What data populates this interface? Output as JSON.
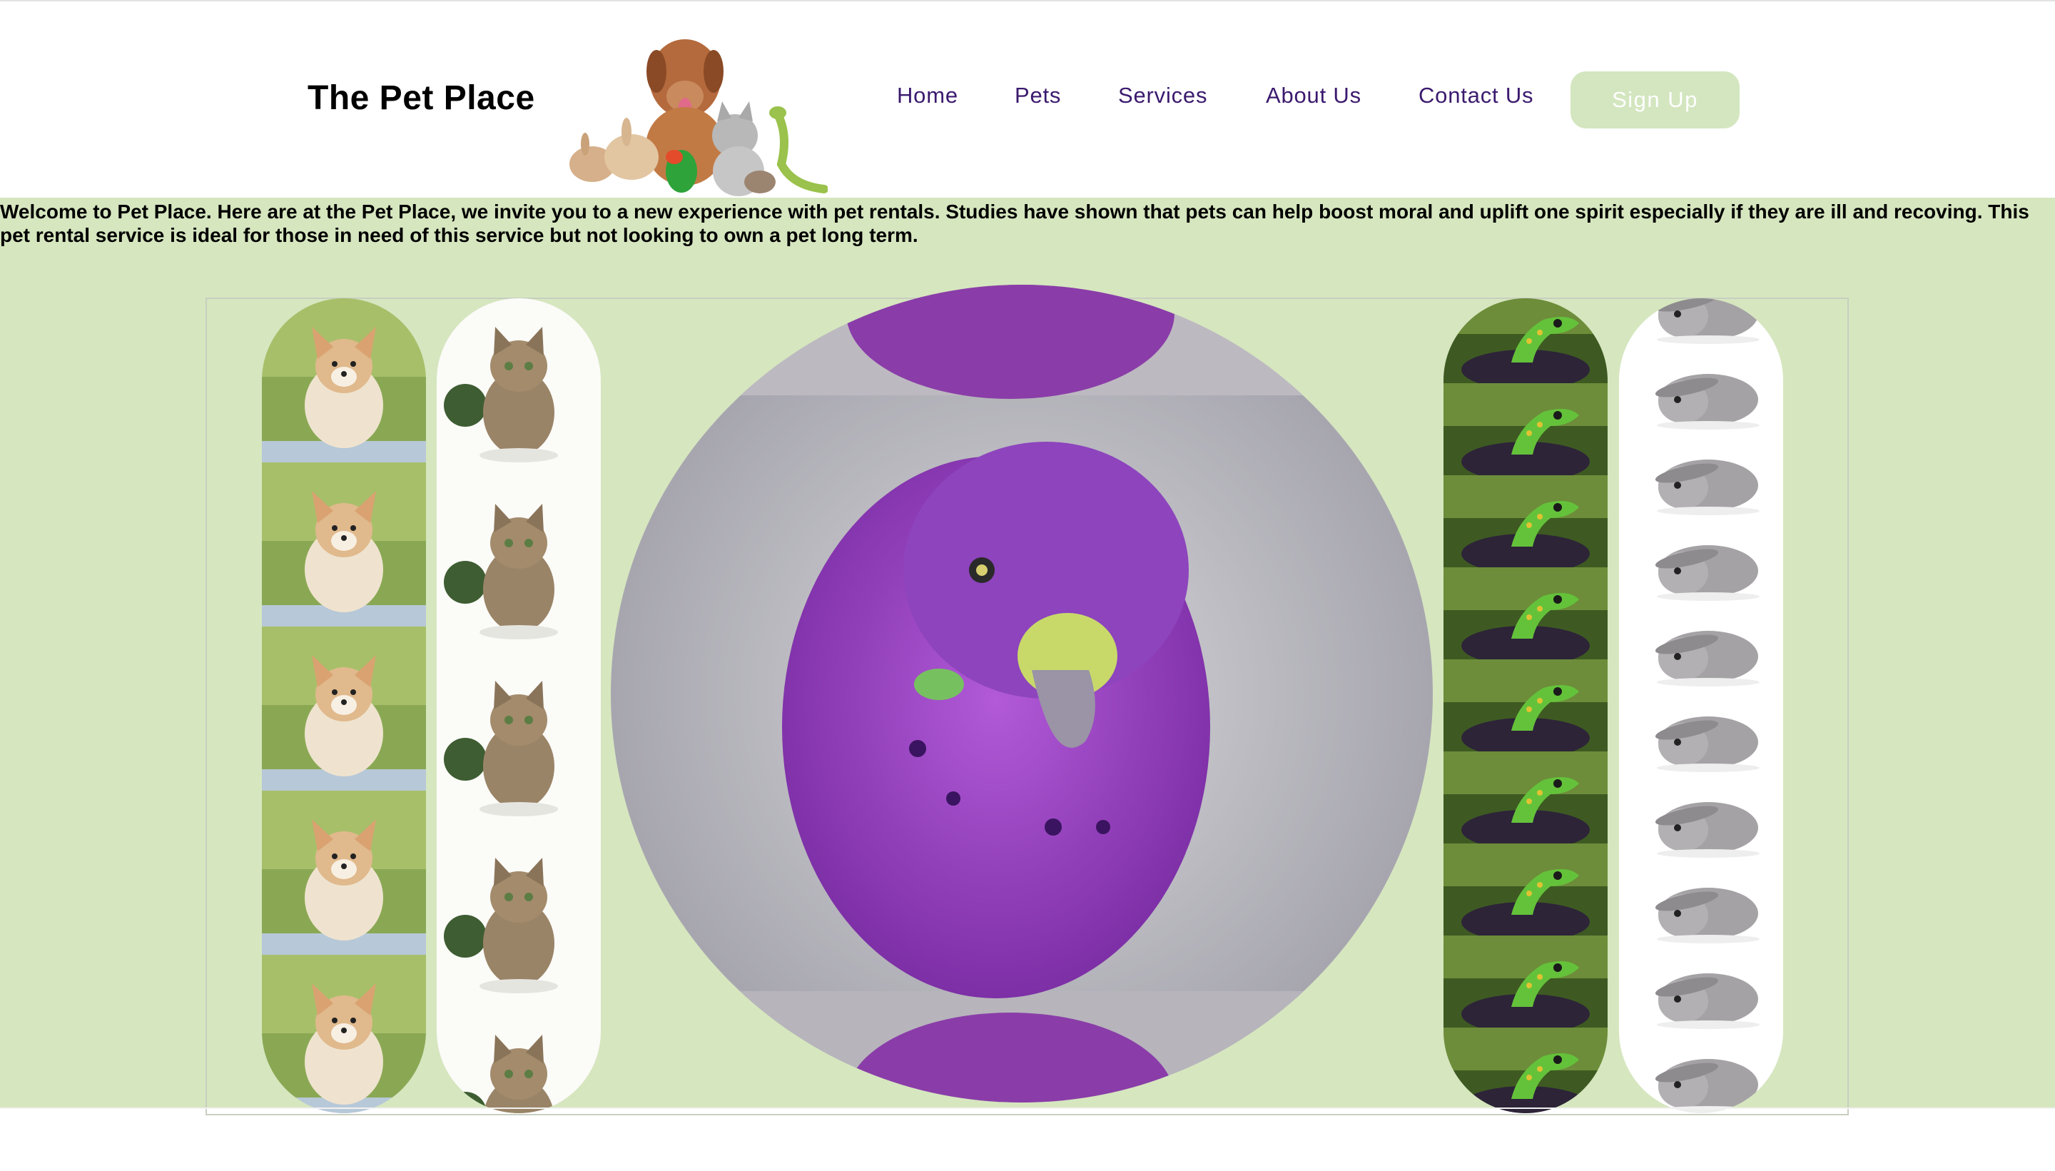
{
  "header": {
    "brand": "The Pet Place",
    "nav": [
      "Home",
      "Pets",
      "Services",
      "About Us",
      "Contact Us"
    ],
    "signup_label": "Sign Up"
  },
  "intro": {
    "text": "Welcome to Pet Place. Here are at the Pet Place, we invite you to a new experience with pet rentals. Studies have shown that pets can help boost moral and uplift one spirit especially if they are ill and recoving. This pet rental service is ideal for those in need of this service but not looking to own a pet long term."
  },
  "gallery": {
    "strips": [
      "corgi-puppy",
      "tabby-kitten",
      "green-gecko",
      "grey-bunny"
    ],
    "center": "purple-budgie"
  },
  "colors": {
    "band": "#d6e6bf",
    "signup_bg": "#d3e6bf",
    "nav_text": "#3b1a6e"
  }
}
